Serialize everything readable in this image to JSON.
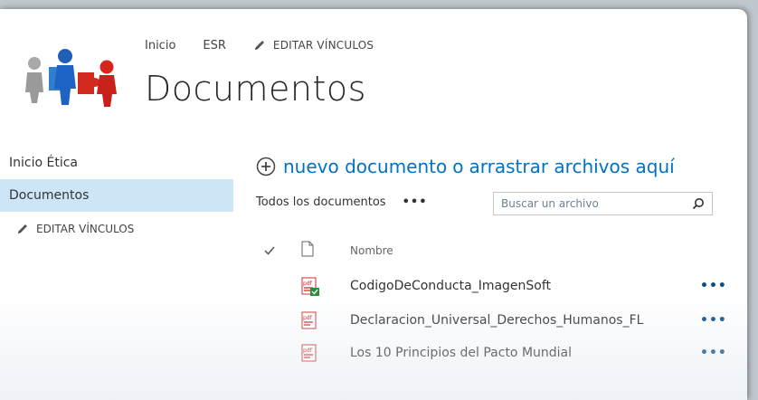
{
  "header": {
    "nav": [
      "Inicio",
      "ESR"
    ],
    "edit_links": "EDITAR VÍNCULOS",
    "title": "Documentos"
  },
  "sidebar": {
    "items": [
      {
        "label": "Inicio Ética",
        "selected": false
      },
      {
        "label": "Documentos",
        "selected": true
      }
    ],
    "edit_links": "EDITAR VÍNCULOS"
  },
  "main": {
    "new_document": "nuevo documento",
    "or": "o",
    "drag": "arrastrar archivos aquí",
    "view_label": "Todos los documentos",
    "view_more": "•••",
    "search": {
      "placeholder": "Buscar un archivo"
    },
    "columns": {
      "name": "Nombre"
    },
    "files": [
      {
        "name": "CodigoDeConducta_ImagenSoft",
        "icon": "pdf-icon-new"
      },
      {
        "name": "Declaracion_Universal_Derechos_Humanos_FL",
        "icon": "pdf-icon"
      },
      {
        "name": "Los 10 Principios del Pacto Mundial",
        "icon": "pdf-icon"
      }
    ],
    "row_more": "•••"
  },
  "colors": {
    "accent": "#0072c6",
    "selected_nav": "#cde6f7",
    "pdf_red": "#d2231e"
  }
}
